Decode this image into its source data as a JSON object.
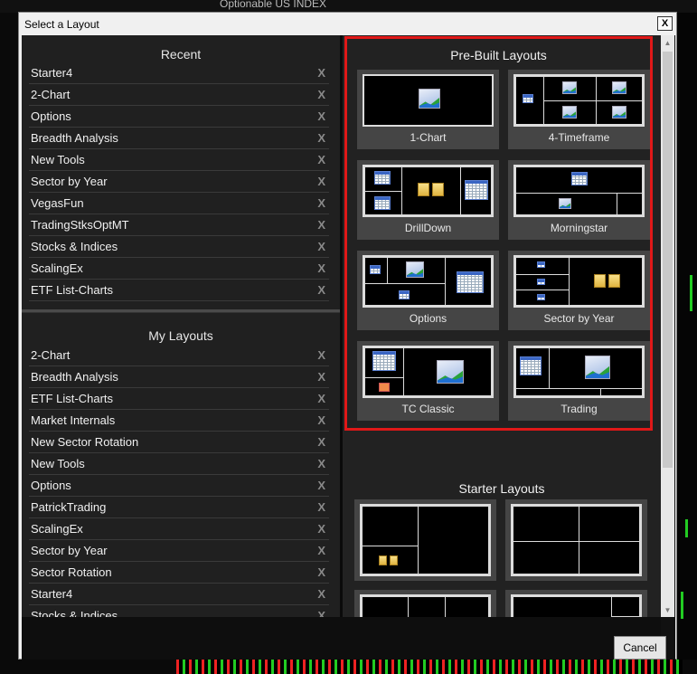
{
  "background": {
    "label": "Optionable   US INDEX"
  },
  "dialog": {
    "title": "Select a Layout",
    "close_label": "X",
    "cancel_label": "Cancel"
  },
  "recent": {
    "title": "Recent",
    "items": [
      {
        "label": "Starter4",
        "remove": "X"
      },
      {
        "label": "2-Chart",
        "remove": "X"
      },
      {
        "label": "Options",
        "remove": "X"
      },
      {
        "label": "Breadth Analysis",
        "remove": "X"
      },
      {
        "label": "New Tools",
        "remove": "X"
      },
      {
        "label": "Sector by Year",
        "remove": "X"
      },
      {
        "label": "VegasFun",
        "remove": "X"
      },
      {
        "label": "TradingStksOptMT",
        "remove": "X"
      },
      {
        "label": "Stocks & Indices",
        "remove": "X"
      },
      {
        "label": "ScalingEx",
        "remove": "X"
      },
      {
        "label": "ETF List-Charts",
        "remove": "X"
      }
    ]
  },
  "my_layouts": {
    "title": "My Layouts",
    "items": [
      {
        "label": "2-Chart",
        "remove": "X"
      },
      {
        "label": "Breadth Analysis",
        "remove": "X"
      },
      {
        "label": "ETF List-Charts",
        "remove": "X"
      },
      {
        "label": "Market Internals",
        "remove": "X"
      },
      {
        "label": "New Sector Rotation",
        "remove": "X"
      },
      {
        "label": "New Tools",
        "remove": "X"
      },
      {
        "label": "Options",
        "remove": "X"
      },
      {
        "label": "PatrickTrading",
        "remove": "X"
      },
      {
        "label": "ScalingEx",
        "remove": "X"
      },
      {
        "label": "Sector by Year",
        "remove": "X"
      },
      {
        "label": "Sector Rotation",
        "remove": "X"
      },
      {
        "label": "Starter4",
        "remove": "X"
      },
      {
        "label": "Stocks & Indices",
        "remove": "X"
      }
    ]
  },
  "prebuilt": {
    "title": "Pre-Built Layouts",
    "highlight_color": "#e01818",
    "tiles": [
      {
        "label": "1-Chart"
      },
      {
        "label": "4-Timeframe"
      },
      {
        "label": "DrillDown"
      },
      {
        "label": "Morningstar"
      },
      {
        "label": "Options"
      },
      {
        "label": "Sector by Year"
      },
      {
        "label": "TC Classic"
      },
      {
        "label": "Trading"
      }
    ]
  },
  "starter": {
    "title": "Starter Layouts"
  }
}
